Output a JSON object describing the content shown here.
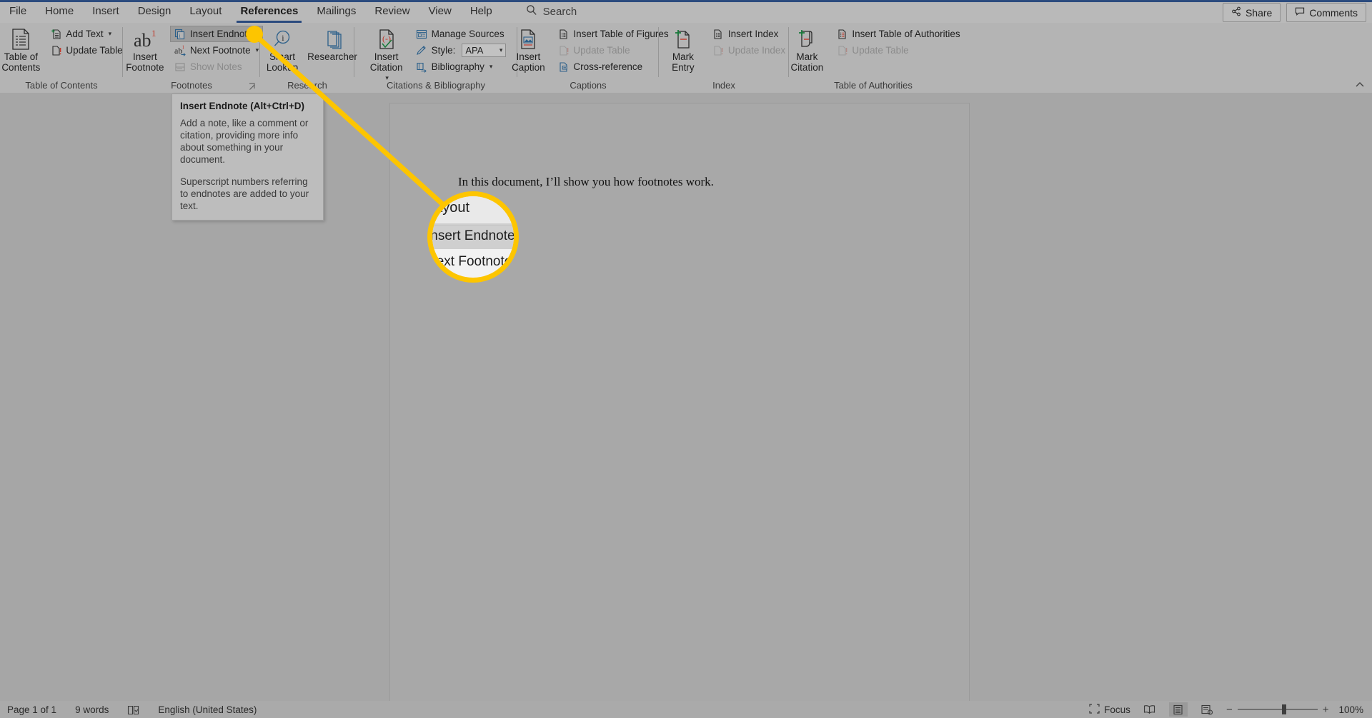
{
  "tabs": [
    {
      "label": "File",
      "active": false
    },
    {
      "label": "Home",
      "active": false
    },
    {
      "label": "Insert",
      "active": false
    },
    {
      "label": "Design",
      "active": false
    },
    {
      "label": "Layout",
      "active": false
    },
    {
      "label": "References",
      "active": true
    },
    {
      "label": "Mailings",
      "active": false
    },
    {
      "label": "Review",
      "active": false
    },
    {
      "label": "View",
      "active": false
    },
    {
      "label": "Help",
      "active": false
    }
  ],
  "search": {
    "label": "Search",
    "icon": "search-icon"
  },
  "titlebar_right": {
    "share": {
      "label": "Share",
      "icon": "share-icon"
    },
    "comments": {
      "label": "Comments",
      "icon": "comment-icon"
    }
  },
  "ribbon": {
    "collapse_icon": "chevron-up-icon",
    "groups": [
      {
        "name": "table-of-contents",
        "label": "Table of Contents",
        "big": [
          {
            "label_line1": "Table of",
            "label_line2": "Contents",
            "icon": "table-of-contents-icon",
            "caret": true
          }
        ],
        "small": [
          {
            "label": "Add Text",
            "icon": "add-text-icon",
            "caret": true,
            "disabled": false
          },
          {
            "label": "Update Table",
            "icon": "update-table-icon",
            "caret": false,
            "disabled": false
          }
        ]
      },
      {
        "name": "footnotes",
        "label": "Footnotes",
        "launcher": true,
        "big": [
          {
            "label_line1": "Insert",
            "label_line2": "Footnote",
            "icon": "insert-footnote-icon",
            "caret": false
          }
        ],
        "small": [
          {
            "label": "Insert Endnote",
            "icon": "insert-endnote-icon",
            "caret": false,
            "disabled": false,
            "hover": true
          },
          {
            "label": "Next Footnote",
            "icon": "next-footnote-icon",
            "caret": true,
            "disabled": false
          },
          {
            "label": "Show Notes",
            "icon": "show-notes-icon",
            "caret": false,
            "disabled": true
          }
        ]
      },
      {
        "name": "research",
        "label": "Research",
        "big": [
          {
            "label_line1": "Smart",
            "label_line2": "Lookup",
            "icon": "smart-lookup-icon",
            "caret": false
          },
          {
            "label_line1": "Researcher",
            "label_line2": "",
            "icon": "researcher-icon",
            "caret": false
          }
        ],
        "small": []
      },
      {
        "name": "citations-bibliography",
        "label": "Citations & Bibliography",
        "big": [
          {
            "label_line1": "Insert",
            "label_line2": "Citation",
            "icon": "insert-citation-icon",
            "caret": true
          }
        ],
        "small": [
          {
            "label": "Manage Sources",
            "icon": "manage-sources-icon",
            "caret": false,
            "disabled": false
          },
          {
            "label": "Style:",
            "icon": "style-icon",
            "caret": false,
            "disabled": false,
            "select": {
              "value": "APA",
              "icon": "chevron-down-icon"
            }
          },
          {
            "label": "Bibliography",
            "icon": "bibliography-icon",
            "caret": true,
            "disabled": false
          }
        ]
      },
      {
        "name": "captions",
        "label": "Captions",
        "big": [
          {
            "label_line1": "Insert",
            "label_line2": "Caption",
            "icon": "insert-caption-icon",
            "caret": false
          }
        ],
        "small": [
          {
            "label": "Insert Table of Figures",
            "icon": "insert-table-of-figures-icon",
            "caret": false,
            "disabled": false
          },
          {
            "label": "Update Table",
            "icon": "update-table-icon",
            "caret": false,
            "disabled": true
          },
          {
            "label": "Cross-reference",
            "icon": "cross-reference-icon",
            "caret": false,
            "disabled": false
          }
        ]
      },
      {
        "name": "index",
        "label": "Index",
        "big": [
          {
            "label_line1": "Mark",
            "label_line2": "Entry",
            "icon": "mark-entry-icon",
            "caret": false
          }
        ],
        "small": [
          {
            "label": "Insert Index",
            "icon": "insert-index-icon",
            "caret": false,
            "disabled": false
          },
          {
            "label": "Update Index",
            "icon": "update-index-icon",
            "caret": false,
            "disabled": true
          }
        ]
      },
      {
        "name": "table-of-authorities",
        "label": "Table of Authorities",
        "big": [
          {
            "label_line1": "Mark",
            "label_line2": "Citation",
            "icon": "mark-citation-icon",
            "caret": false
          }
        ],
        "small": [
          {
            "label": "Insert Table of Authorities",
            "icon": "insert-table-of-authorities-icon",
            "caret": false,
            "disabled": false
          },
          {
            "label": "Update Table",
            "icon": "update-table-icon",
            "caret": false,
            "disabled": true
          }
        ]
      }
    ]
  },
  "tooltip": {
    "title": "Insert Endnote (Alt+Ctrl+D)",
    "body1": "Add a note, like a comment or citation, providing more info about something in your document.",
    "body2": "Superscript numbers referring to endnotes are added to your text."
  },
  "document": {
    "text": "In this document, I’ll show you how footnotes work."
  },
  "callout": {
    "color": "#fdc500",
    "lens": {
      "tab_label": "Layout",
      "row1": "Insert Endnote",
      "row2": "Next Footnote"
    }
  },
  "statusbar": {
    "page": "Page 1 of 1",
    "words": "9 words",
    "proofing_icon": "proofing-icon",
    "language": "English (United States)",
    "focus": {
      "label": "Focus",
      "icon": "focus-icon"
    },
    "views": [
      {
        "name": "read-mode",
        "icon": "read-mode-icon",
        "active": false
      },
      {
        "name": "print-layout",
        "icon": "print-layout-icon",
        "active": true
      },
      {
        "name": "web-layout",
        "icon": "web-layout-icon",
        "active": false
      }
    ],
    "zoom_out": "−",
    "zoom_in": "+",
    "zoom_level": "100%"
  }
}
